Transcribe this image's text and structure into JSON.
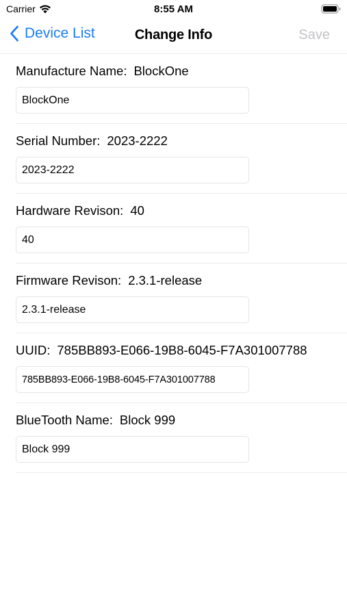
{
  "status_bar": {
    "carrier": "Carrier",
    "time": "8:55 AM"
  },
  "nav": {
    "back_label": "Device List",
    "title": "Change Info",
    "save_label": "Save",
    "accent_color": "#1a7cf6",
    "disabled_color": "#c3c3c7"
  },
  "fields": [
    {
      "label": "Manufacture Name:",
      "value": "BlockOne",
      "input": "BlockOne"
    },
    {
      "label": "Serial Number:",
      "value": "2023-2222",
      "input": "2023-2222"
    },
    {
      "label": "Hardware Revison:",
      "value": "40",
      "input": "40"
    },
    {
      "label": "Firmware Revison:",
      "value": "2.3.1-release",
      "input": "2.3.1-release"
    },
    {
      "label": "UUID:",
      "value": "785BB893-E066-19B8-6045-F7A301007788",
      "input": "785BB893-E066-19B8-6045-F7A301007788"
    },
    {
      "label": "BlueTooth Name:",
      "value": "Block 999",
      "input": "Block 999"
    }
  ]
}
